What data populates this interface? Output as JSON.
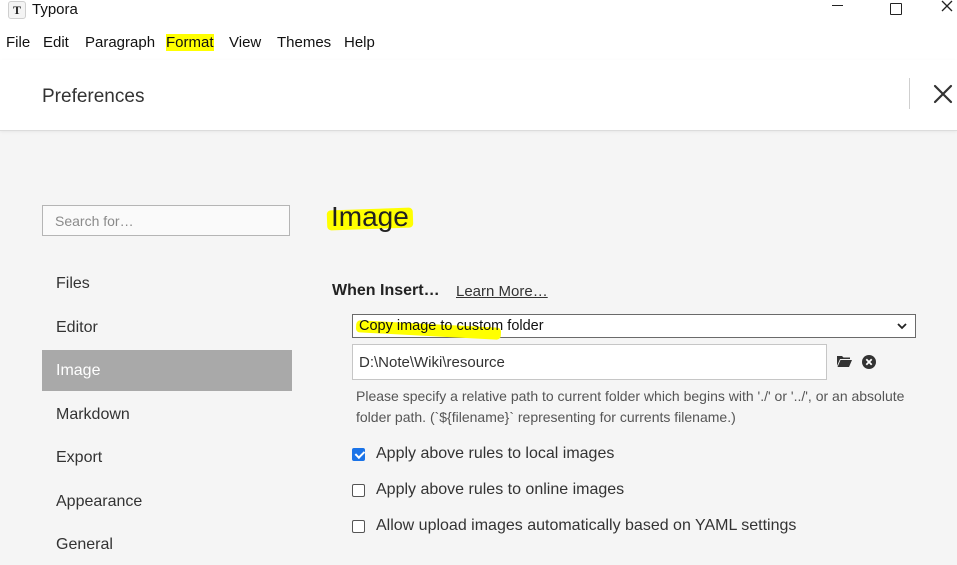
{
  "window": {
    "app_icon": "T",
    "title": "Typora"
  },
  "menu": {
    "items": [
      "File",
      "Edit",
      "Paragraph",
      "Format",
      "View",
      "Themes",
      "Help"
    ]
  },
  "header": {
    "title": "Preferences"
  },
  "sidebar": {
    "search_placeholder": "Search for…",
    "items": [
      {
        "label": "Files"
      },
      {
        "label": "Editor"
      },
      {
        "label": "Image"
      },
      {
        "label": "Markdown"
      },
      {
        "label": "Export"
      },
      {
        "label": "Appearance"
      },
      {
        "label": "General"
      }
    ],
    "active_index": 2
  },
  "image_section": {
    "title": "Image",
    "when_insert_label": "When Insert…",
    "learn_more_label": "Learn More…",
    "action_selected": "Copy image to custom folder",
    "path_value": "D:\\Note\\Wiki\\resource",
    "help_text": "Please specify a relative path to current folder which begins with './' or '../', or an absolute folder path. (`${filename}` representing for currents filename.)",
    "options": [
      {
        "label": "Apply above rules to local images",
        "checked": true
      },
      {
        "label": "Apply above rules to online images",
        "checked": false
      },
      {
        "label": "Allow upload images automatically based on YAML settings",
        "checked": false
      }
    ]
  },
  "colors": {
    "highlight": "#ffff00",
    "active_nav": "#a9a9a9",
    "checkbox_accent": "#1a73e8"
  },
  "icons": [
    "app-icon",
    "minimize-icon",
    "maximize-icon",
    "close-icon",
    "chevron-down-icon",
    "folder-icon",
    "clear-icon",
    "checkbox-icon"
  ]
}
